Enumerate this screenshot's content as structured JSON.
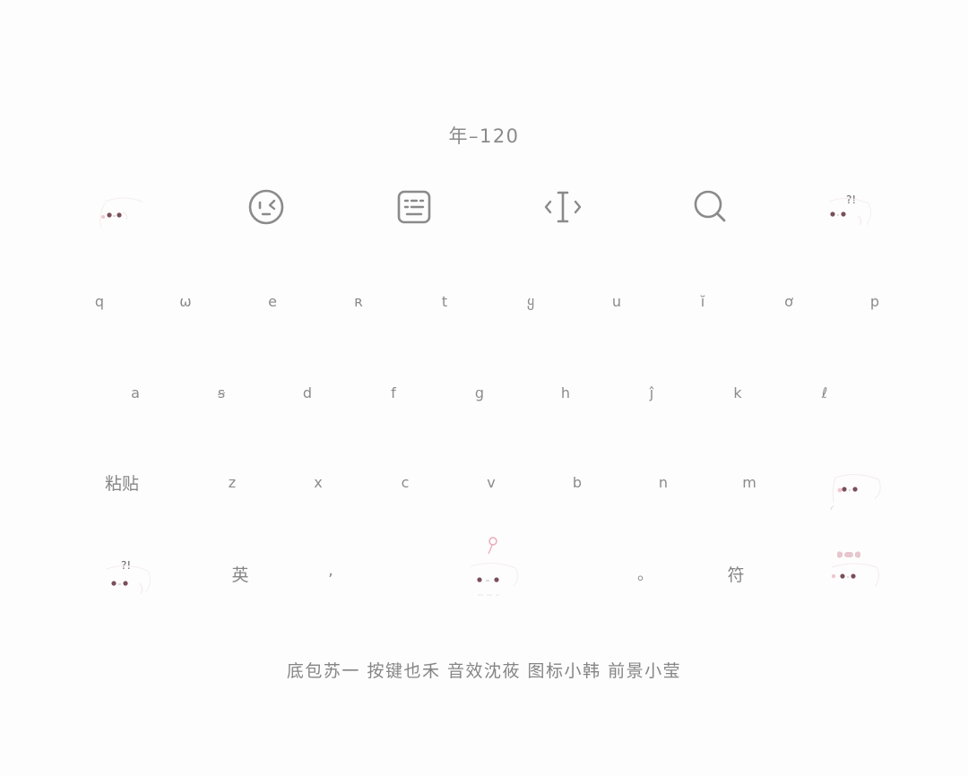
{
  "keyboard": {
    "title": "年–120",
    "toolbar": {
      "icons": [
        "sticker-face-icon",
        "emoji-icon",
        "keyboard-icon",
        "cursor-move-icon",
        "search-icon",
        "sticker-face-question-icon"
      ],
      "question_mark": "?!"
    },
    "row1": [
      "q",
      "ω",
      "e",
      "ʀ",
      "t",
      "ყ",
      "u",
      "ĭ",
      "ơ",
      "p"
    ],
    "row2": [
      "a",
      "ꞩ",
      "d",
      "f",
      "ց",
      "h",
      "ĵ",
      "k",
      "ℓ"
    ],
    "row3": {
      "paste_label": "粘贴",
      "letters": [
        "z",
        "x",
        "c",
        "v",
        "b",
        "n",
        "m"
      ]
    },
    "bottom_row": {
      "symbol_sticker_label": "?!",
      "lang_label": "英",
      "comma_label": ",",
      "period_label": "。",
      "symbols_label": "符"
    },
    "credits": "底包苏一 按键也禾 音效沈莜 图标小韩 前景小莹",
    "colors": {
      "background": "#fefdfd",
      "text": "#8a8a8a",
      "eye": "#7a4f5a",
      "blush": "#e8a7b4",
      "bow": "#e6c6cf"
    }
  }
}
